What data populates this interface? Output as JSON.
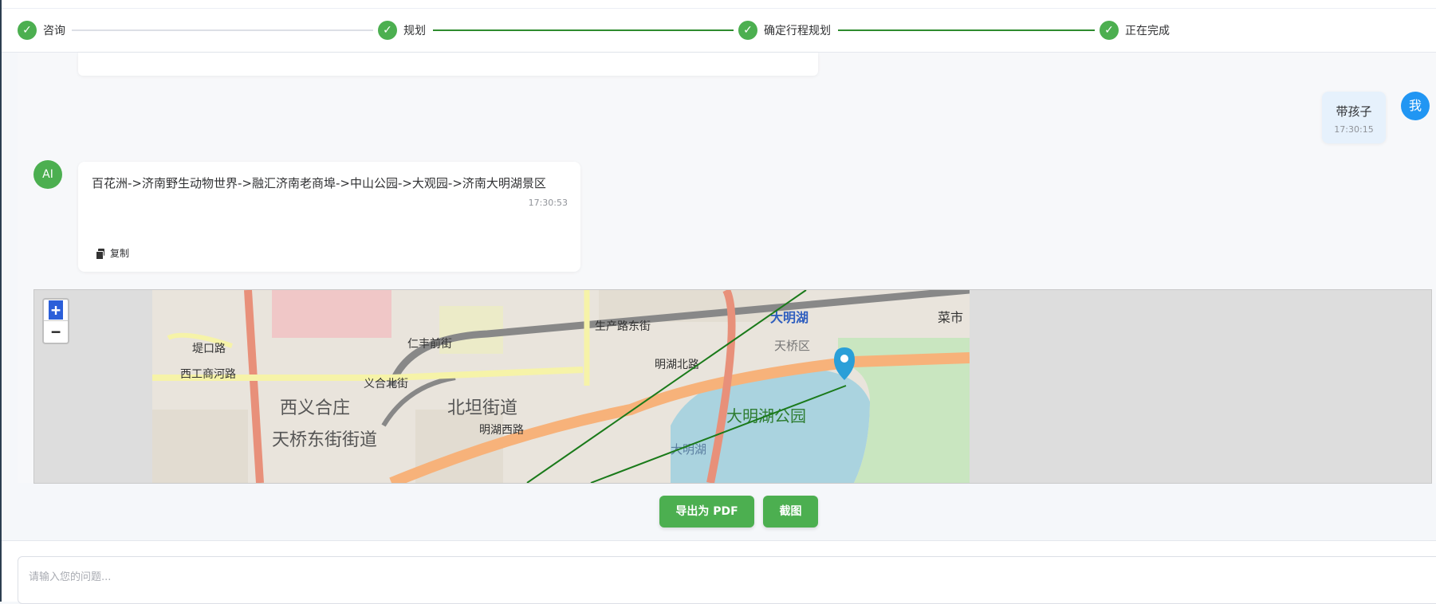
{
  "steps": [
    {
      "label": "咨询",
      "done": true
    },
    {
      "label": "规划",
      "done": true
    },
    {
      "label": "确定行程规划",
      "done": true
    },
    {
      "label": "正在完成",
      "done": true
    }
  ],
  "check_glyph": "✓",
  "messages": {
    "user": {
      "avatar": "我",
      "text": "带孩子",
      "time": "17:30:15"
    },
    "ai": {
      "avatar": "AI",
      "text": "百花洲->济南野生动物世界->融汇济南老商埠->中山公园->大观园->济南大明湖景区",
      "time": "17:30:53",
      "copy_label": "复制"
    }
  },
  "map": {
    "zoom_in": "+",
    "zoom_out": "−",
    "labels": {
      "road1": "堤口路",
      "road2": "西工商河路",
      "road3": "仁丰前街",
      "road4": "生产路东街",
      "road5": "义合北街",
      "district1": "西义合庄",
      "district2": "北坦街道",
      "district3": "天桥东街街道",
      "road6": "明湖北路",
      "road7": "明湖西路",
      "area1": "天桥区",
      "lake": "大明湖",
      "lake2": "大明湖",
      "park": "大明湖公园",
      "market": "菜市"
    }
  },
  "actions": {
    "export_pdf": "导出为 PDF",
    "screenshot": "截图"
  },
  "input": {
    "placeholder": "请输入您的问题..."
  },
  "colors": {
    "green": "#4caf50",
    "route": "#1a7a1a",
    "blue": "#2196f3"
  }
}
